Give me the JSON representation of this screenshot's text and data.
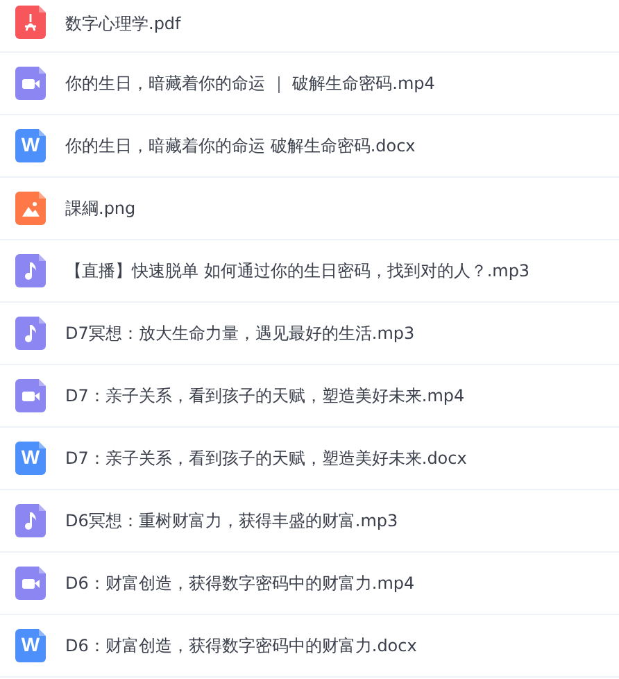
{
  "files": [
    {
      "name": "数字心理学.pdf",
      "kind": "pdf"
    },
    {
      "name": "你的生日，暗藏着你的命运 ｜ 破解生命密码.mp4",
      "kind": "video"
    },
    {
      "name": "你的生日，暗藏着你的命运 破解生命密码.docx",
      "kind": "word",
      "icon_text": "W"
    },
    {
      "name": "課綱.png",
      "kind": "image"
    },
    {
      "name": "【直播】快速脱单 如何通过你的生日密码，找到对的人？.mp3",
      "kind": "audio"
    },
    {
      "name": "D7冥想：放大生命力量，遇见最好的生活.mp3",
      "kind": "audio"
    },
    {
      "name": "D7：亲子关系，看到孩子的天赋，塑造美好未来.mp4",
      "kind": "video"
    },
    {
      "name": "D7：亲子关系，看到孩子的天赋，塑造美好未来.docx",
      "kind": "word",
      "icon_text": "W"
    },
    {
      "name": "D6冥想：重树财富力，获得丰盛的财富.mp3",
      "kind": "audio"
    },
    {
      "name": "D6：财富创造，获得数字密码中的财富力.mp4",
      "kind": "video"
    },
    {
      "name": "D6：财富创造，获得数字密码中的财富力.docx",
      "kind": "word",
      "icon_text": "W"
    }
  ]
}
